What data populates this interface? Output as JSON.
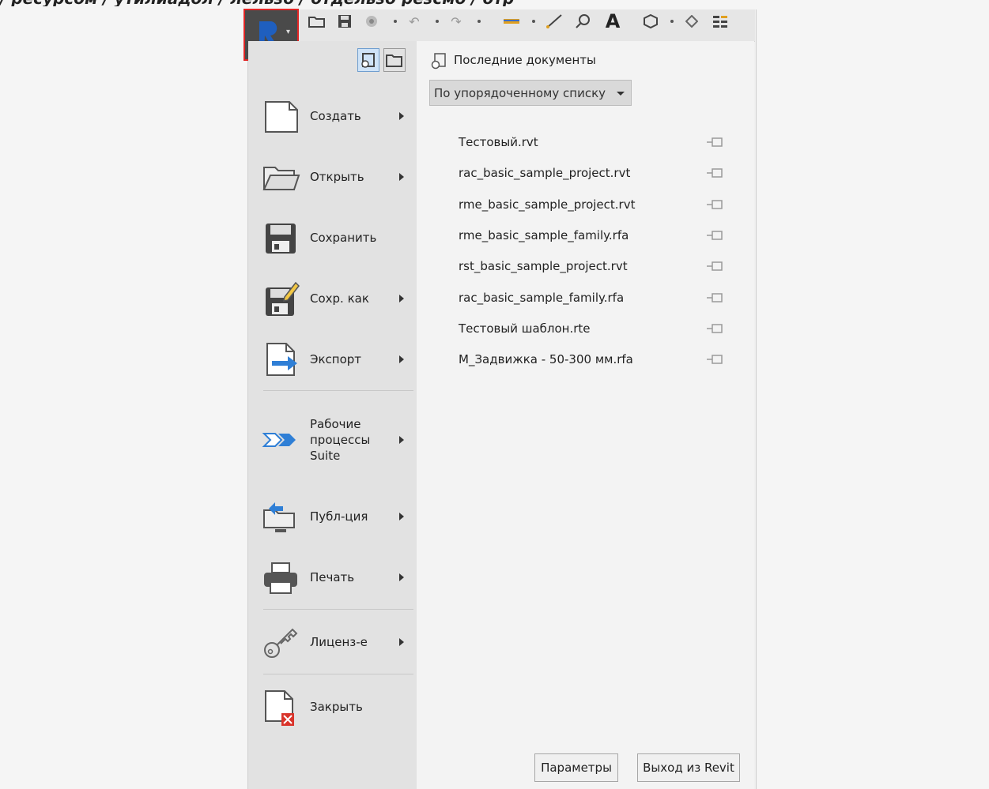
{
  "menu": {
    "items": [
      {
        "label": "Создать",
        "icon": "new-document-icon",
        "has_submenu": true
      },
      {
        "label": "Открыть",
        "icon": "open-folder-icon",
        "has_submenu": true
      },
      {
        "label": "Сохранить",
        "icon": "save-icon",
        "has_submenu": false
      },
      {
        "label": "Сохр. как",
        "icon": "save-as-icon",
        "has_submenu": true
      },
      {
        "label": "Экспорт",
        "icon": "export-icon",
        "has_submenu": true
      },
      {
        "label": "Рабочие процессы Suite",
        "icon": "suite-workflows-icon",
        "has_submenu": true
      },
      {
        "label": "Публ-ция",
        "icon": "publish-icon",
        "has_submenu": true
      },
      {
        "label": "Печать",
        "icon": "print-icon",
        "has_submenu": true
      },
      {
        "label": "Лиценз-е",
        "icon": "license-key-icon",
        "has_submenu": true
      },
      {
        "label": "Закрыть",
        "icon": "close-document-icon",
        "has_submenu": false
      }
    ]
  },
  "recent": {
    "title": "Последние документы",
    "sort_dropdown": "По упорядоченному списку",
    "documents": [
      "Тестовый.rvt",
      "rac_basic_sample_project.rvt",
      "rme_basic_sample_project.rvt",
      "rme_basic_sample_family.rfa",
      "rst_basic_sample_project.rvt",
      "rac_basic_sample_family.rfa",
      "Тестовый шаблон.rte",
      "M_Задвижка - 50-300 мм.rfa"
    ]
  },
  "footer": {
    "options_label": "Параметры",
    "exit_label": "Выход из Revit"
  },
  "colors": {
    "highlight_border": "#e12626",
    "app_button": "#4a4a4a",
    "revit_logo": "#1f5fbf"
  }
}
